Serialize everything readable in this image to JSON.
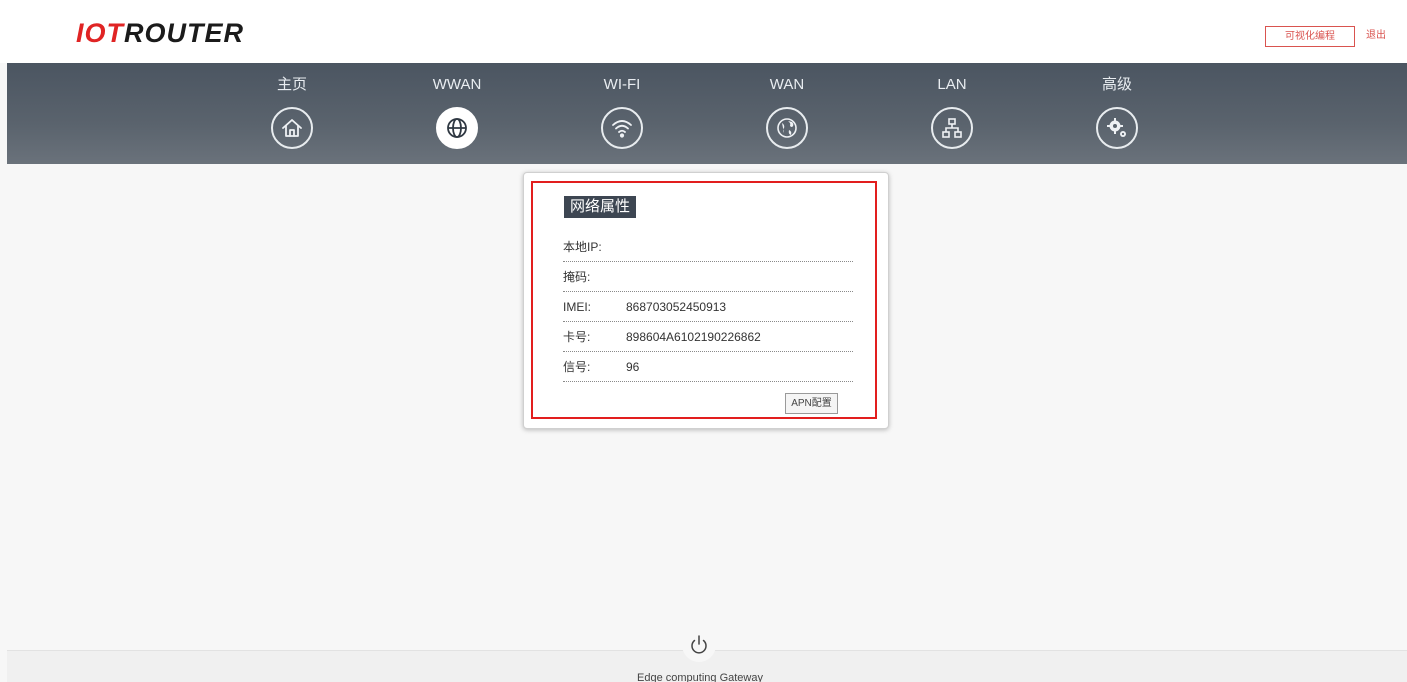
{
  "header": {
    "logo_part1": "IOT",
    "logo_part2": "ROUTER",
    "visual_programming_label": "可视化编程",
    "logout_label": "退出"
  },
  "nav": {
    "items": [
      {
        "label": "主页",
        "icon": "home-icon"
      },
      {
        "label": "WWAN",
        "icon": "globe-icon",
        "active": true
      },
      {
        "label": "WI-FI",
        "icon": "wifi-icon"
      },
      {
        "label": "WAN",
        "icon": "earth-icon"
      },
      {
        "label": "LAN",
        "icon": "network-icon"
      },
      {
        "label": "高级",
        "icon": "gears-icon"
      }
    ]
  },
  "panel": {
    "title": "网络属性",
    "rows": [
      {
        "label": "本地IP:",
        "value": ""
      },
      {
        "label": "掩码:",
        "value": ""
      },
      {
        "label": "IMEI:",
        "value": "868703052450913"
      },
      {
        "label": "卡号:",
        "value": "898604A6102190226862"
      },
      {
        "label": "信号:",
        "value": "96"
      }
    ],
    "apn_button_label": "APN配置"
  },
  "footer": {
    "power_icon": "power-icon",
    "text": "Edge computing Gateway"
  },
  "colors": {
    "accent_red": "#e21e1e",
    "nav_bg": "#555e68",
    "title_bg": "#3d4652"
  }
}
